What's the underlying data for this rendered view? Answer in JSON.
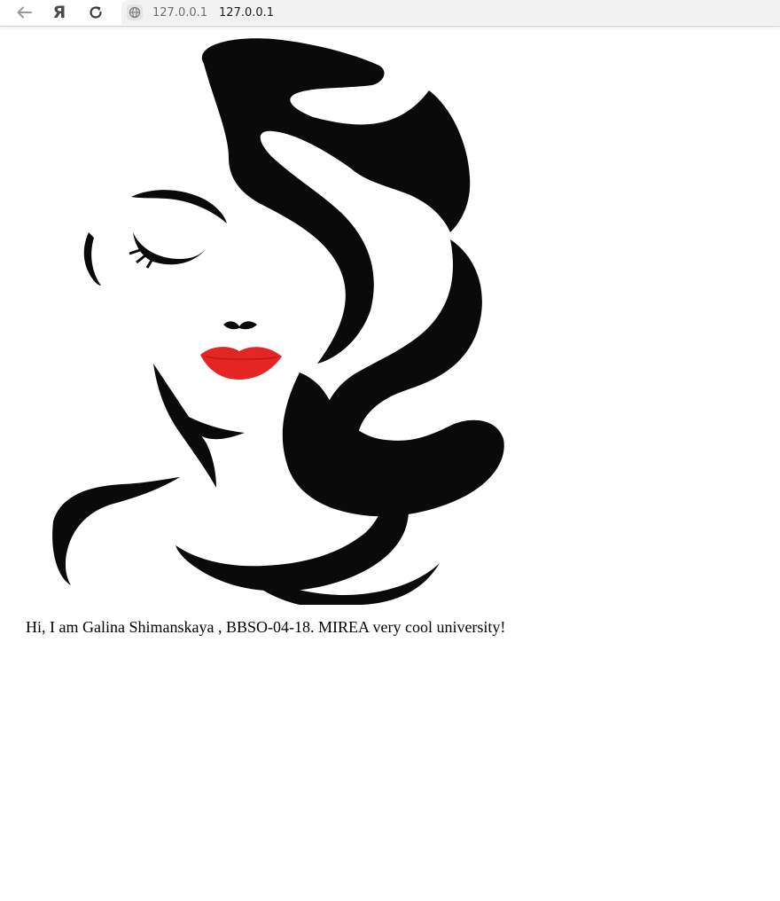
{
  "browser": {
    "yandex_label": "Я",
    "address_host": "127.0.0.1",
    "page_title": "127.0.0.1"
  },
  "page": {
    "caption": "Hi, I am Galina Shimanskaya , BBSO-04-18. MIREA very cool university!"
  },
  "colors": {
    "hair": "#0a0a0a",
    "lips": "#e52424",
    "background": "#ffffff"
  }
}
